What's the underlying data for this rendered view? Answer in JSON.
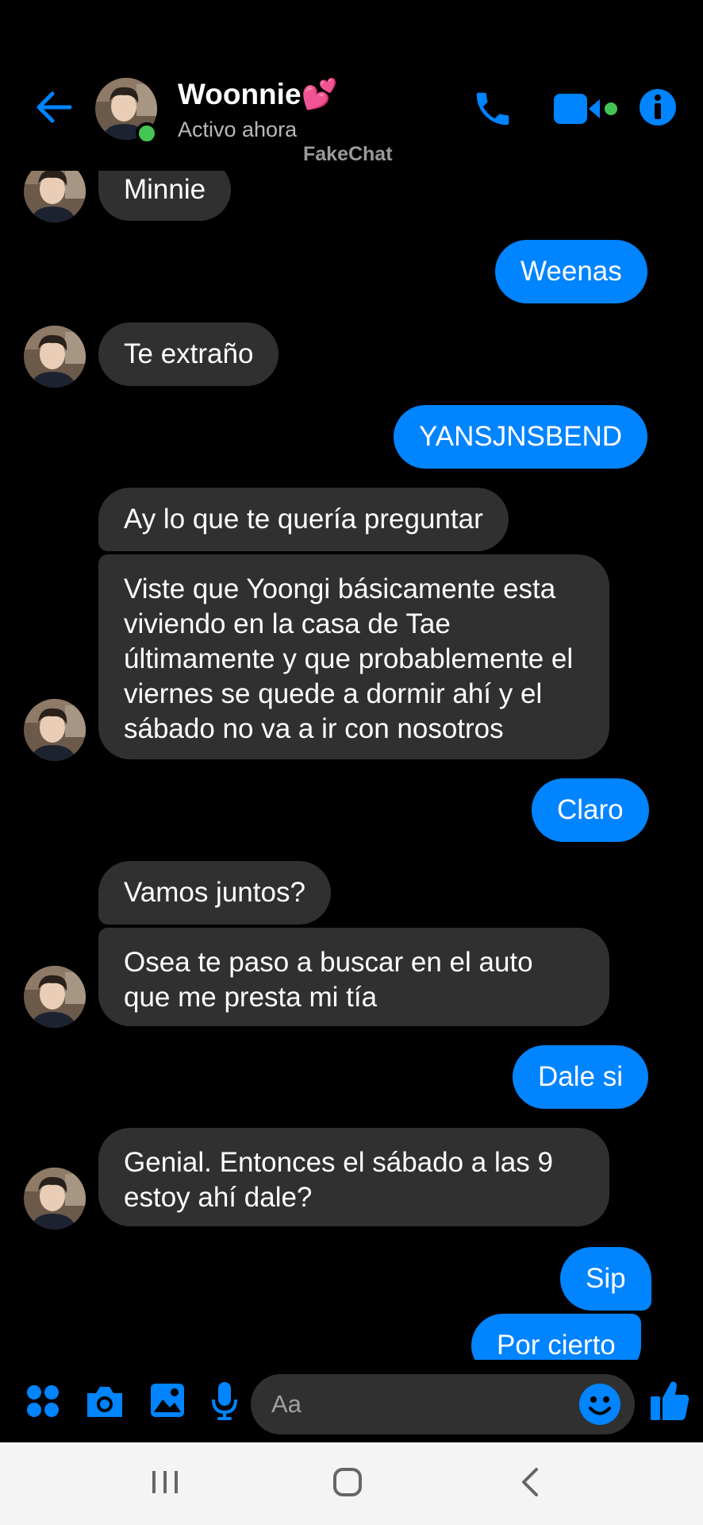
{
  "header": {
    "contact_name": "Woonnie💕",
    "status": "Activo ahora",
    "watermark": "FakeChat",
    "icons": [
      "back-arrow-icon",
      "phone-icon",
      "video-camera-icon",
      "info-icon"
    ]
  },
  "messages": [
    {
      "side": "in",
      "text": "Minnie"
    },
    {
      "side": "out",
      "text": "Weenas"
    },
    {
      "side": "in",
      "text": "Te extraño"
    },
    {
      "side": "out",
      "text": "YANSJNSBEND"
    },
    {
      "side": "in",
      "text": "Ay lo que te quería preguntar"
    },
    {
      "side": "in",
      "text": "Viste que Yoongi básicamente esta viviendo en la casa de Tae últimamente y que probablemente el viernes se quede a dormir ahí y el sábado no va a ir con nosotros"
    },
    {
      "side": "out",
      "text": "Claro"
    },
    {
      "side": "in",
      "text": "Vamos juntos?"
    },
    {
      "side": "in",
      "text": "Osea te paso a buscar en el auto que me presta mi tía"
    },
    {
      "side": "out",
      "text": "Dale si"
    },
    {
      "side": "in",
      "text": "Genial. Entonces el sábado a las 9 estoy ahí dale?"
    },
    {
      "side": "out",
      "text": "Sip"
    },
    {
      "side": "out",
      "text": "Por cierto"
    }
  ],
  "composer": {
    "placeholder": "Aa",
    "icons": [
      "apps-menu-icon",
      "camera-icon",
      "gallery-icon",
      "microphone-icon",
      "emoji-icon",
      "thumbs-up-icon"
    ]
  },
  "system_nav": {
    "icons": [
      "recent-apps-icon",
      "home-icon",
      "back-icon"
    ]
  },
  "colors": {
    "accent": "#0084ff",
    "incoming_bubble": "#303030",
    "background": "#000000",
    "online": "#44c553"
  }
}
